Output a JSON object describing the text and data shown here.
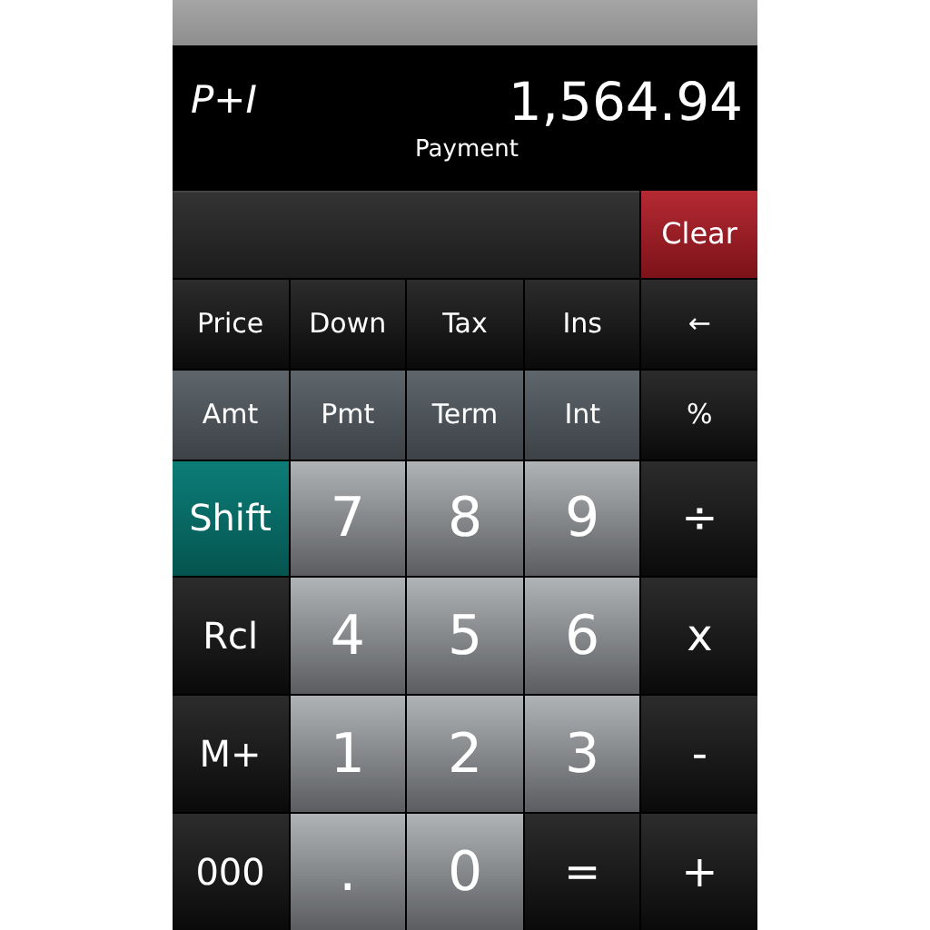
{
  "display": {
    "mode": "P+I",
    "value": "1,564.94",
    "label": "Payment"
  },
  "clear_button": "Clear",
  "key_rows": [
    [
      {
        "label": "Price",
        "kind": "function"
      },
      {
        "label": "Down",
        "kind": "function"
      },
      {
        "label": "Tax",
        "kind": "function"
      },
      {
        "label": "Ins",
        "kind": "function"
      },
      {
        "label": "←",
        "kind": "operator"
      }
    ],
    [
      {
        "label": "Amt",
        "kind": "variable"
      },
      {
        "label": "Pmt",
        "kind": "variable"
      },
      {
        "label": "Term",
        "kind": "variable"
      },
      {
        "label": "Int",
        "kind": "variable"
      },
      {
        "label": "%",
        "kind": "operator"
      }
    ],
    [
      {
        "label": "Shift",
        "kind": "shift"
      },
      {
        "label": "7",
        "kind": "digit"
      },
      {
        "label": "8",
        "kind": "digit"
      },
      {
        "label": "9",
        "kind": "digit"
      },
      {
        "label": "÷",
        "kind": "operator"
      }
    ],
    [
      {
        "label": "Rcl",
        "kind": "function"
      },
      {
        "label": "4",
        "kind": "digit"
      },
      {
        "label": "5",
        "kind": "digit"
      },
      {
        "label": "6",
        "kind": "digit"
      },
      {
        "label": "x",
        "kind": "operator"
      }
    ],
    [
      {
        "label": "M+",
        "kind": "function"
      },
      {
        "label": "1",
        "kind": "digit"
      },
      {
        "label": "2",
        "kind": "digit"
      },
      {
        "label": "3",
        "kind": "digit"
      },
      {
        "label": "-",
        "kind": "operator"
      }
    ],
    [
      {
        "label": "000",
        "kind": "function"
      },
      {
        "label": ".",
        "kind": "digit"
      },
      {
        "label": "0",
        "kind": "digit"
      },
      {
        "label": "=",
        "kind": "operator"
      },
      {
        "label": "+",
        "kind": "operator"
      }
    ]
  ]
}
